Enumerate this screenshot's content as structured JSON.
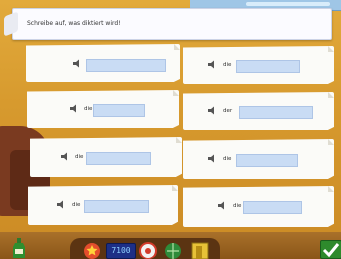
{
  "instruction": "Schreibe auf, was diktiert wird!",
  "cards": [
    {
      "article": ""
    },
    {
      "article": "die"
    },
    {
      "article": "die"
    },
    {
      "article": "der"
    },
    {
      "article": "die"
    },
    {
      "article": "die"
    },
    {
      "article": "die"
    },
    {
      "article": "die"
    }
  ],
  "toolbar": {
    "clock": "7100"
  },
  "colors": {
    "field": "#c9dcf4",
    "card": "#fbfbf8",
    "background": "#d79a2e",
    "check": "#2e8a2c"
  },
  "icons": [
    "speaker-icon",
    "bottle-icon",
    "star-icon",
    "info-icon",
    "globe-icon",
    "door-icon",
    "check-icon"
  ]
}
